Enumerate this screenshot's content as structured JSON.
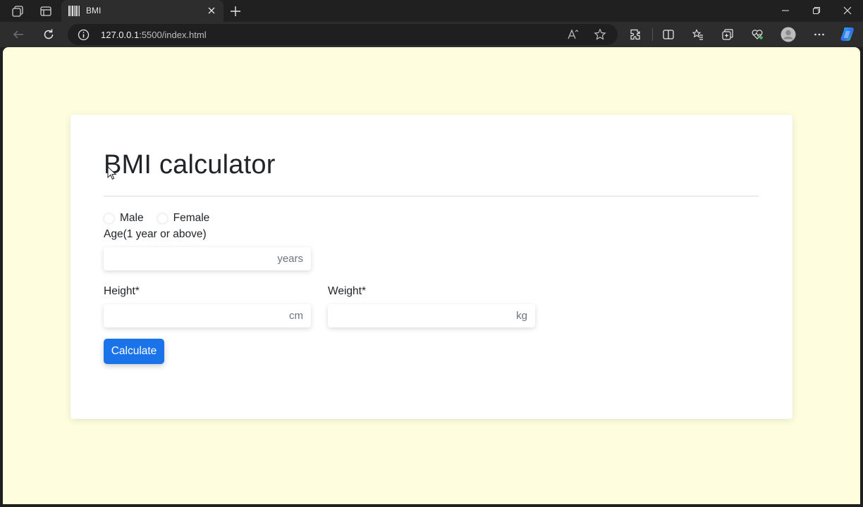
{
  "browser": {
    "tab_title": "BMI",
    "url_host": "127.0.0.1",
    "url_path": ":5500/index.html"
  },
  "page": {
    "title": "BMI calculator",
    "gender_options": [
      "Male",
      "Female"
    ],
    "age_label": "Age(1 year or above)",
    "age_unit": "years",
    "height_label": "Height*",
    "height_unit": "cm",
    "weight_label": "Weight*",
    "weight_unit": "kg",
    "calculate_label": "Calculate"
  },
  "colors": {
    "page_background": "#fefedf",
    "button_primary": "#1a73e8"
  }
}
